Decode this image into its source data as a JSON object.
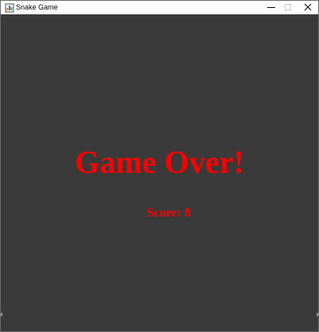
{
  "window": {
    "title": "Snake Game",
    "icons": {
      "app": "app-icon",
      "minimize": "minimize-icon",
      "maximize": "maximize-icon",
      "close": "close-icon"
    }
  },
  "game": {
    "message": "Game Over!",
    "score_text": "Score: 8",
    "colors": {
      "background": "#3a3a3a",
      "text": "#ff0000"
    }
  }
}
